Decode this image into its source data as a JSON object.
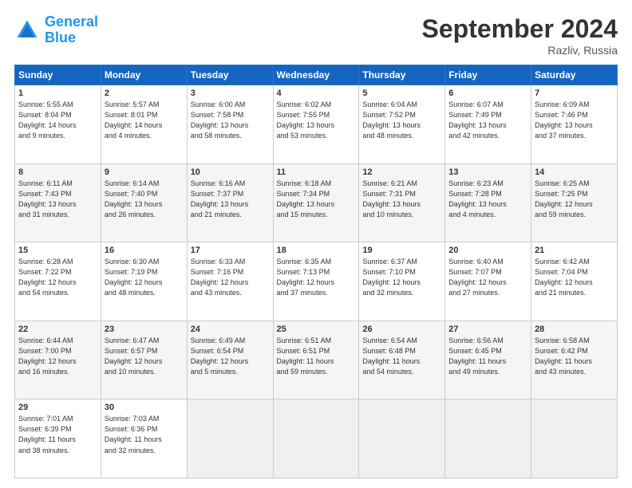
{
  "header": {
    "logo_general": "General",
    "logo_blue": "Blue",
    "month_title": "September 2024",
    "location": "Razliv, Russia"
  },
  "days_of_week": [
    "Sunday",
    "Monday",
    "Tuesday",
    "Wednesday",
    "Thursday",
    "Friday",
    "Saturday"
  ],
  "weeks": [
    [
      {
        "day": "1",
        "info": "Sunrise: 5:55 AM\nSunset: 8:04 PM\nDaylight: 14 hours\nand 9 minutes."
      },
      {
        "day": "2",
        "info": "Sunrise: 5:57 AM\nSunset: 8:01 PM\nDaylight: 14 hours\nand 4 minutes."
      },
      {
        "day": "3",
        "info": "Sunrise: 6:00 AM\nSunset: 7:58 PM\nDaylight: 13 hours\nand 58 minutes."
      },
      {
        "day": "4",
        "info": "Sunrise: 6:02 AM\nSunset: 7:55 PM\nDaylight: 13 hours\nand 53 minutes."
      },
      {
        "day": "5",
        "info": "Sunrise: 6:04 AM\nSunset: 7:52 PM\nDaylight: 13 hours\nand 48 minutes."
      },
      {
        "day": "6",
        "info": "Sunrise: 6:07 AM\nSunset: 7:49 PM\nDaylight: 13 hours\nand 42 minutes."
      },
      {
        "day": "7",
        "info": "Sunrise: 6:09 AM\nSunset: 7:46 PM\nDaylight: 13 hours\nand 37 minutes."
      }
    ],
    [
      {
        "day": "8",
        "info": "Sunrise: 6:11 AM\nSunset: 7:43 PM\nDaylight: 13 hours\nand 31 minutes."
      },
      {
        "day": "9",
        "info": "Sunrise: 6:14 AM\nSunset: 7:40 PM\nDaylight: 13 hours\nand 26 minutes."
      },
      {
        "day": "10",
        "info": "Sunrise: 6:16 AM\nSunset: 7:37 PM\nDaylight: 13 hours\nand 21 minutes."
      },
      {
        "day": "11",
        "info": "Sunrise: 6:18 AM\nSunset: 7:34 PM\nDaylight: 13 hours\nand 15 minutes."
      },
      {
        "day": "12",
        "info": "Sunrise: 6:21 AM\nSunset: 7:31 PM\nDaylight: 13 hours\nand 10 minutes."
      },
      {
        "day": "13",
        "info": "Sunrise: 6:23 AM\nSunset: 7:28 PM\nDaylight: 13 hours\nand 4 minutes."
      },
      {
        "day": "14",
        "info": "Sunrise: 6:25 AM\nSunset: 7:25 PM\nDaylight: 12 hours\nand 59 minutes."
      }
    ],
    [
      {
        "day": "15",
        "info": "Sunrise: 6:28 AM\nSunset: 7:22 PM\nDaylight: 12 hours\nand 54 minutes."
      },
      {
        "day": "16",
        "info": "Sunrise: 6:30 AM\nSunset: 7:19 PM\nDaylight: 12 hours\nand 48 minutes."
      },
      {
        "day": "17",
        "info": "Sunrise: 6:33 AM\nSunset: 7:16 PM\nDaylight: 12 hours\nand 43 minutes."
      },
      {
        "day": "18",
        "info": "Sunrise: 6:35 AM\nSunset: 7:13 PM\nDaylight: 12 hours\nand 37 minutes."
      },
      {
        "day": "19",
        "info": "Sunrise: 6:37 AM\nSunset: 7:10 PM\nDaylight: 12 hours\nand 32 minutes."
      },
      {
        "day": "20",
        "info": "Sunrise: 6:40 AM\nSunset: 7:07 PM\nDaylight: 12 hours\nand 27 minutes."
      },
      {
        "day": "21",
        "info": "Sunrise: 6:42 AM\nSunset: 7:04 PM\nDaylight: 12 hours\nand 21 minutes."
      }
    ],
    [
      {
        "day": "22",
        "info": "Sunrise: 6:44 AM\nSunset: 7:00 PM\nDaylight: 12 hours\nand 16 minutes."
      },
      {
        "day": "23",
        "info": "Sunrise: 6:47 AM\nSunset: 6:57 PM\nDaylight: 12 hours\nand 10 minutes."
      },
      {
        "day": "24",
        "info": "Sunrise: 6:49 AM\nSunset: 6:54 PM\nDaylight: 12 hours\nand 5 minutes."
      },
      {
        "day": "25",
        "info": "Sunrise: 6:51 AM\nSunset: 6:51 PM\nDaylight: 11 hours\nand 59 minutes."
      },
      {
        "day": "26",
        "info": "Sunrise: 6:54 AM\nSunset: 6:48 PM\nDaylight: 11 hours\nand 54 minutes."
      },
      {
        "day": "27",
        "info": "Sunrise: 6:56 AM\nSunset: 6:45 PM\nDaylight: 11 hours\nand 49 minutes."
      },
      {
        "day": "28",
        "info": "Sunrise: 6:58 AM\nSunset: 6:42 PM\nDaylight: 11 hours\nand 43 minutes."
      }
    ],
    [
      {
        "day": "29",
        "info": "Sunrise: 7:01 AM\nSunset: 6:39 PM\nDaylight: 11 hours\nand 38 minutes."
      },
      {
        "day": "30",
        "info": "Sunrise: 7:03 AM\nSunset: 6:36 PM\nDaylight: 11 hours\nand 32 minutes."
      },
      {
        "day": "",
        "info": ""
      },
      {
        "day": "",
        "info": ""
      },
      {
        "day": "",
        "info": ""
      },
      {
        "day": "",
        "info": ""
      },
      {
        "day": "",
        "info": ""
      }
    ]
  ]
}
